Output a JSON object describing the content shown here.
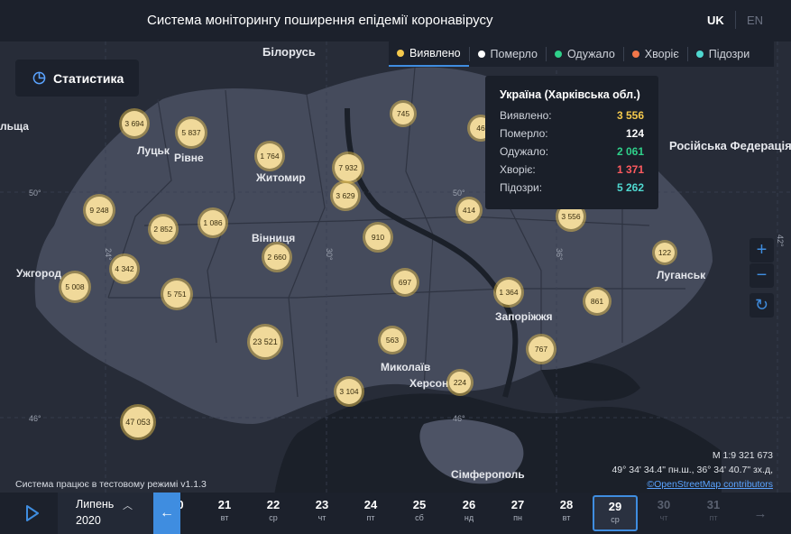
{
  "header": {
    "title": "Система моніторингу поширення епідемії коронавірусу",
    "lang_uk": "UK",
    "lang_en": "EN"
  },
  "stats_button": {
    "label": "Статистика",
    "icon": "pie-chart-icon"
  },
  "legend": [
    {
      "label": "Виявлено",
      "color": "#f5c94c",
      "active": true
    },
    {
      "label": "Померло",
      "color": "#ffffff",
      "active": false
    },
    {
      "label": "Одужало",
      "color": "#2fd08a",
      "active": false
    },
    {
      "label": "Хворіє",
      "color": "#f2774a",
      "active": false
    },
    {
      "label": "Підозри",
      "color": "#4fd8d0",
      "active": false
    }
  ],
  "tooltip": {
    "title": "Україна (Харківська обл.)",
    "rows": [
      {
        "label": "Виявлено:",
        "value": "3 556",
        "color": "#f5c94c"
      },
      {
        "label": "Померло:",
        "value": "124",
        "color": "#ffffff"
      },
      {
        "label": "Одужало:",
        "value": "2 061",
        "color": "#2fd08a"
      },
      {
        "label": "Хворіє:",
        "value": "1 371",
        "color": "#ff5a5f"
      },
      {
        "label": "Підозри:",
        "value": "5 262",
        "color": "#4fd8d0"
      }
    ]
  },
  "map_labels": {
    "belarus": "Білорусь",
    "russia": "Російська Федерація",
    "poland": "льща",
    "lutsk": "Луцьк",
    "rivne": "Рівне",
    "zhytomyr": "Житомир",
    "vinnytsia": "Вінниця",
    "uzhhorod": "Ужгород",
    "zaporizhzhia": "Запоріжжя",
    "mykolaiv": "Миколаїв",
    "kherson": "Херсон",
    "luhansk": "Луганськ",
    "simferopol": "Сімферополь",
    "lat50a": "50°",
    "lat50b": "50°",
    "lat46a": "46°",
    "lat46b": "46°",
    "lon24": "24°",
    "lon30": "30°",
    "lon36": "36°",
    "lon42": "42°"
  },
  "clusters": [
    {
      "label": "3 694"
    },
    {
      "label": "5 837"
    },
    {
      "label": "1 764"
    },
    {
      "label": "7 932"
    },
    {
      "label": "745"
    },
    {
      "label": "46"
    },
    {
      "label": "3 629"
    },
    {
      "label": "9 248"
    },
    {
      "label": "2 852"
    },
    {
      "label": "1 086"
    },
    {
      "label": "910"
    },
    {
      "label": "414"
    },
    {
      "label": "3 556"
    },
    {
      "label": "122"
    },
    {
      "label": "4 342"
    },
    {
      "label": "2 660"
    },
    {
      "label": "5 008"
    },
    {
      "label": "5 751"
    },
    {
      "label": "697"
    },
    {
      "label": "1 364"
    },
    {
      "label": "861"
    },
    {
      "label": "23 521"
    },
    {
      "label": "563"
    },
    {
      "label": "767"
    },
    {
      "label": "3 104"
    },
    {
      "label": "224"
    },
    {
      "label": "47 053"
    }
  ],
  "map_info": {
    "scale": "М 1:9 321 673",
    "coords": "49° 34' 34.4\" пн.ш., 36° 34' 40.7\" зх.д,",
    "osm": "©OpenStreetMap contributors",
    "test_mode": "Система працює в тестовому режимі v1.1.3"
  },
  "controls": {
    "zoom_in": "+",
    "zoom_out": "−",
    "reset": "↻"
  },
  "timeline": {
    "month": "Липень",
    "year": "2020",
    "partial_day": "0",
    "days": [
      {
        "num": "21",
        "wd": "вт",
        "state": "past"
      },
      {
        "num": "22",
        "wd": "ср",
        "state": "past"
      },
      {
        "num": "23",
        "wd": "чт",
        "state": "past"
      },
      {
        "num": "24",
        "wd": "пт",
        "state": "past"
      },
      {
        "num": "25",
        "wd": "сб",
        "state": "past"
      },
      {
        "num": "26",
        "wd": "нд",
        "state": "past"
      },
      {
        "num": "27",
        "wd": "пн",
        "state": "past"
      },
      {
        "num": "28",
        "wd": "вт",
        "state": "past"
      },
      {
        "num": "29",
        "wd": "ср",
        "state": "selected"
      },
      {
        "num": "30",
        "wd": "чт",
        "state": "future"
      },
      {
        "num": "31",
        "wd": "пт",
        "state": "future"
      }
    ]
  }
}
